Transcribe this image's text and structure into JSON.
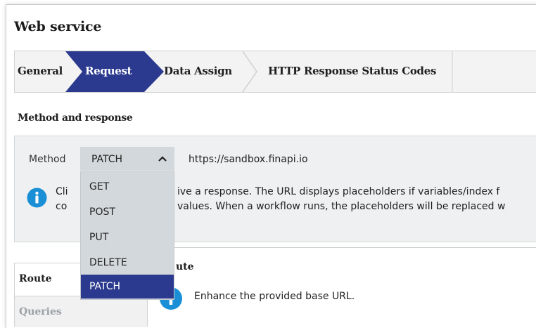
{
  "dialog": {
    "title": "Web service"
  },
  "tabs": [
    {
      "label": "General",
      "active": false
    },
    {
      "label": "Request",
      "active": true
    },
    {
      "label": "Data Assign",
      "active": false
    },
    {
      "label": "HTTP Response Status Codes",
      "active": false
    }
  ],
  "method_section": {
    "heading": "Method and response",
    "method_label": "Method",
    "selected_method": "PATCH",
    "url": "https://sandbox.finapi.io",
    "info_line1_left": "Cli",
    "info_line1_right": "ive a response. The URL displays placeholders if variables/index f",
    "info_line2_left": "co",
    "info_line2_right": "values. When a workflow runs, the placeholders will be replaced w"
  },
  "method_dropdown": {
    "options": [
      "GET",
      "POST",
      "PUT",
      "DELETE",
      "PATCH"
    ],
    "selected": "PATCH"
  },
  "route_section": {
    "title": "ute",
    "description": "Enhance the provided base URL.",
    "side_items": [
      "Route",
      "Queries"
    ]
  },
  "colors": {
    "accent": "#2b3a8e",
    "tab_bar_bg": "#f3f3f3",
    "panel_bg": "#eef0f1",
    "select_bg": "#d3d8dc",
    "info_icon": "#1a8fd6"
  },
  "icons": {
    "chevron": "chevron-up-icon",
    "info": "info-icon"
  }
}
